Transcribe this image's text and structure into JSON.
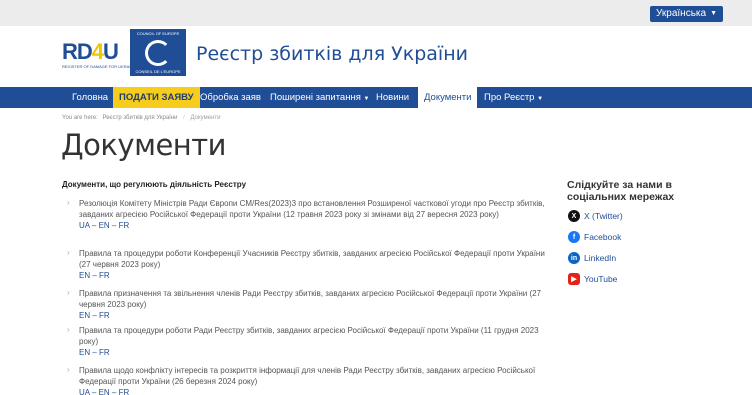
{
  "topbar": {
    "language": "Українська"
  },
  "header": {
    "rd4u_text": "RD4U",
    "rd4u_sub": "REGISTER OF DAMAGE FOR UKRAINE",
    "coe_top": "COUNCIL OF EUROPE",
    "coe_bottom": "CONSEIL DE L'EUROPE",
    "site_title": "Реєстр збитків для України"
  },
  "nav": [
    {
      "label": "Головна"
    },
    {
      "label": "ПОДАТИ ЗАЯВУ"
    },
    {
      "label": "Обробка заяв"
    },
    {
      "label": "Поширені запитання"
    },
    {
      "label": "Новини"
    },
    {
      "label": "Документи"
    },
    {
      "label": "Про Реєстр"
    }
  ],
  "breadcrumb": {
    "prefix": "You are here:",
    "home": "Реєстр збитків для України",
    "current": "Документи"
  },
  "page_title": "Документи",
  "section_head": "Документи, що регулюють діяльність Реєстру",
  "documents": [
    {
      "text": "Резолюція Комітету Міністрів Ради Європи CM/Res(2023)3 про встановлення Розширеної часткової угоди про Реєстр збитків, завданих агресією Російської Федерації проти України (12 травня 2023 року зі змінами від 27 вересня 2023 року)",
      "links": "UA – EN – FR"
    },
    {
      "text": "Правила та процедури роботи Конференції Учасників Реєстру збитків, завданих агресією Російської Федерації проти України (27 червня 2023 року)",
      "links": "EN – FR"
    },
    {
      "text": "Правила призначення та звільнення членів Ради Реєстру збитків, завданих агресією Російської Федерації проти України (27 червня 2023 року)",
      "links": "EN – FR"
    },
    {
      "text": "Правила та процедури роботи Ради Реєстру збитків, завданих агресією Російської Федерації проти України (11 грудня 2023 року)",
      "links": "EN – FR"
    },
    {
      "text": "Правила щодо конфлікту інтересів та розкриття інформації для членів Ради Реєстру збитків, завданих агресією Російської Федерації проти України (26 березня 2024 року)",
      "links": "UA – EN – FR"
    }
  ],
  "sidebar": {
    "title": "Слідкуйте за нами в соціальних мережах",
    "social": [
      {
        "label": "X (Twitter)",
        "icon": "x-icon"
      },
      {
        "label": "Facebook",
        "icon": "facebook-icon"
      },
      {
        "label": "LinkedIn",
        "icon": "linkedin-icon"
      },
      {
        "label": "YouTube",
        "icon": "youtube-icon"
      }
    ]
  },
  "colors": {
    "brand_blue": "#1f4d96",
    "apply_yellow": "#f6cc1d"
  }
}
